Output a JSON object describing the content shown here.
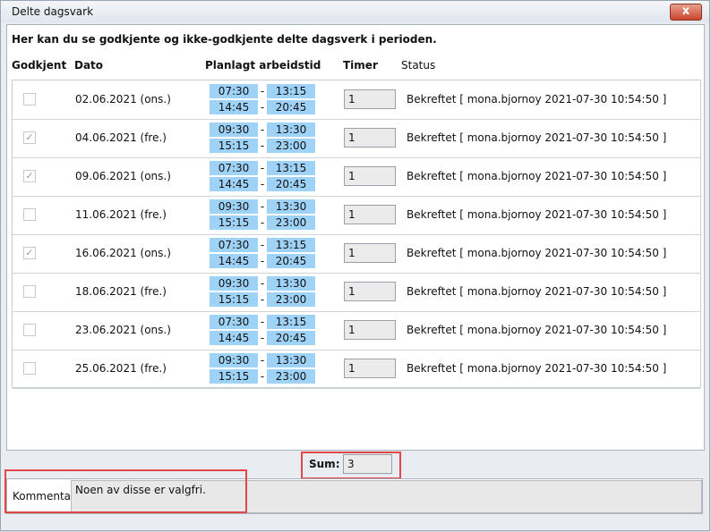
{
  "window": {
    "title": "Delte dagsvark",
    "close_label": "x"
  },
  "intro": "Her kan du se godkjente og ikke-godkjente delte dagsverk i perioden.",
  "headers": {
    "approved": "Godkjent",
    "date": "Dato",
    "planned": "Planlagt arbeidstid",
    "hours": "Timer",
    "status": "Status"
  },
  "rows": [
    {
      "checked": false,
      "date": "02.06.2021 (ons.)",
      "start1": "07:30",
      "end1": "13:15",
      "start2": "14:45",
      "end2": "20:45",
      "hours": "1",
      "status": "Bekreftet [ mona.bjornoy 2021-07-30 10:54:50 ]"
    },
    {
      "checked": true,
      "date": "04.06.2021 (fre.)",
      "start1": "09:30",
      "end1": "13:30",
      "start2": "15:15",
      "end2": "23:00",
      "hours": "1",
      "status": "Bekreftet [ mona.bjornoy 2021-07-30 10:54:50 ]"
    },
    {
      "checked": true,
      "date": "09.06.2021 (ons.)",
      "start1": "07:30",
      "end1": "13:15",
      "start2": "14:45",
      "end2": "20:45",
      "hours": "1",
      "status": "Bekreftet [ mona.bjornoy 2021-07-30 10:54:50 ]"
    },
    {
      "checked": false,
      "date": "11.06.2021 (fre.)",
      "start1": "09:30",
      "end1": "13:30",
      "start2": "15:15",
      "end2": "23:00",
      "hours": "1",
      "status": "Bekreftet [ mona.bjornoy 2021-07-30 10:54:50 ]"
    },
    {
      "checked": true,
      "date": "16.06.2021 (ons.)",
      "start1": "07:30",
      "end1": "13:15",
      "start2": "14:45",
      "end2": "20:45",
      "hours": "1",
      "status": "Bekreftet [ mona.bjornoy 2021-07-30 10:54:50 ]"
    },
    {
      "checked": false,
      "date": "18.06.2021 (fre.)",
      "start1": "09:30",
      "end1": "13:30",
      "start2": "15:15",
      "end2": "23:00",
      "hours": "1",
      "status": "Bekreftet [ mona.bjornoy 2021-07-30 10:54:50 ]"
    },
    {
      "checked": false,
      "date": "23.06.2021 (ons.)",
      "start1": "07:30",
      "end1": "13:15",
      "start2": "14:45",
      "end2": "20:45",
      "hours": "1",
      "status": "Bekreftet [ mona.bjornoy 2021-07-30 10:54:50 ]"
    },
    {
      "checked": false,
      "date": "25.06.2021 (fre.)",
      "start1": "09:30",
      "end1": "13:30",
      "start2": "15:15",
      "end2": "23:00",
      "hours": "1",
      "status": "Bekreftet [ mona.bjornoy 2021-07-30 10:54:50 ]"
    }
  ],
  "time_separator": "-",
  "check_glyph": "✓",
  "sum": {
    "label": "Sum:",
    "value": "3"
  },
  "comment": {
    "label": "Kommentar",
    "value": "Noen av disse er valgfri."
  },
  "colors": {
    "time_bg": "#9fd2f7",
    "highlight": "#e04848"
  }
}
